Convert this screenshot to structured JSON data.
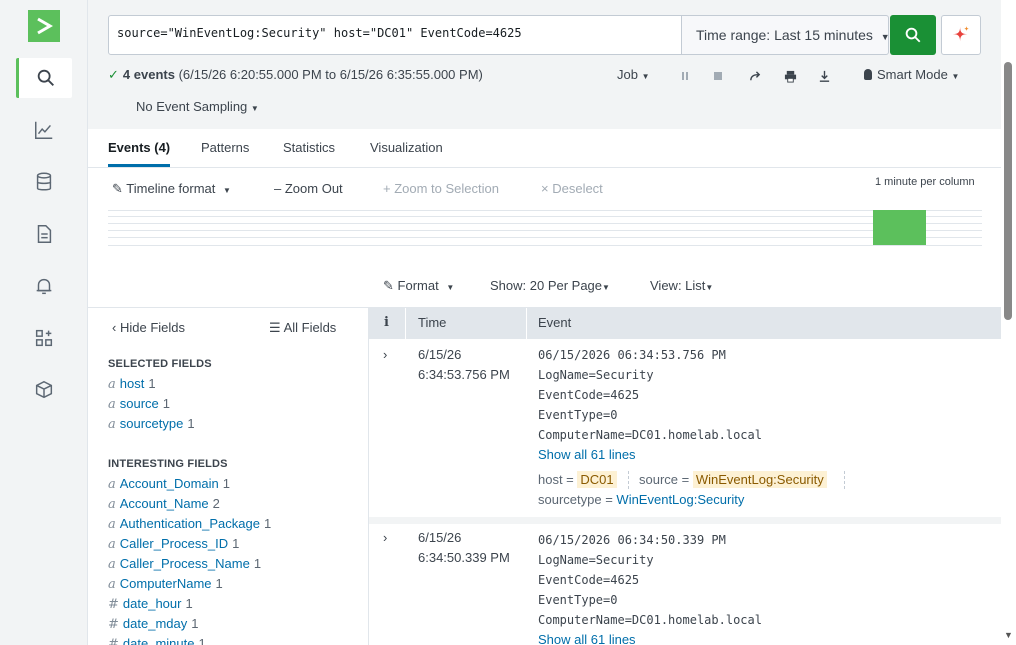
{
  "search": {
    "query": "source=\"WinEventLog:Security\" host=\"DC01\" EventCode=4625",
    "time_range": "Time range: Last 15 minutes"
  },
  "status": {
    "count_label": "4 events",
    "range": "(6/15/26 6:20:55.000 PM to 6/15/26 6:35:55.000 PM)",
    "job": "Job",
    "smart_mode": "Smart Mode",
    "sampling": "No Event Sampling"
  },
  "tabs": [
    "Events (4)",
    "Patterns",
    "Statistics",
    "Visualization"
  ],
  "timeline": {
    "format": "Timeline format",
    "zoom_out": "Zoom Out",
    "zoom_sel": "Zoom to Selection",
    "deselect": "Deselect",
    "per_column": "1 minute per column",
    "bar_fraction": 1.0
  },
  "results_ctrl": {
    "format": "Format",
    "show": "Show: 20 Per Page",
    "view": "View: List"
  },
  "fields": {
    "hide": "Hide Fields",
    "all": "All Fields",
    "selected_title": "SELECTED FIELDS",
    "selected": [
      {
        "type": "a",
        "name": "host",
        "count": "1"
      },
      {
        "type": "a",
        "name": "source",
        "count": "1"
      },
      {
        "type": "a",
        "name": "sourcetype",
        "count": "1"
      }
    ],
    "interesting_title": "INTERESTING FIELDS",
    "interesting": [
      {
        "type": "a",
        "name": "Account_Domain",
        "count": "1"
      },
      {
        "type": "a",
        "name": "Account_Name",
        "count": "2"
      },
      {
        "type": "a",
        "name": "Authentication_Package",
        "count": "1"
      },
      {
        "type": "a",
        "name": "Caller_Process_ID",
        "count": "1"
      },
      {
        "type": "a",
        "name": "Caller_Process_Name",
        "count": "1"
      },
      {
        "type": "a",
        "name": "ComputerName",
        "count": "1"
      },
      {
        "type": "#",
        "name": "date_hour",
        "count": "1"
      },
      {
        "type": "#",
        "name": "date_mday",
        "count": "1"
      },
      {
        "type": "#",
        "name": "date_minute",
        "count": "1"
      }
    ]
  },
  "table": {
    "col_i": "i",
    "col_time": "Time",
    "col_event": "Event"
  },
  "events": [
    {
      "date": "6/15/26",
      "time": "6:34:53.756 PM",
      "lines": [
        "06/15/2026 06:34:53.756 PM",
        "LogName=Security",
        "EventCode=4625",
        "EventType=0",
        "ComputerName=DC01.homelab.local"
      ],
      "show_all": "Show all 61 lines",
      "host_label": "host =",
      "host": "DC01",
      "source_label": "source =",
      "source": "WinEventLog:Security",
      "sourcetype_label": "sourcetype =",
      "sourcetype": "WinEventLog:Security"
    },
    {
      "date": "6/15/26",
      "time": "6:34:50.339 PM",
      "lines": [
        "06/15/2026 06:34:50.339 PM",
        "LogName=Security",
        "EventCode=4625",
        "EventType=0",
        "ComputerName=DC01.homelab.local"
      ],
      "show_all": "Show all 61 lines"
    }
  ]
}
